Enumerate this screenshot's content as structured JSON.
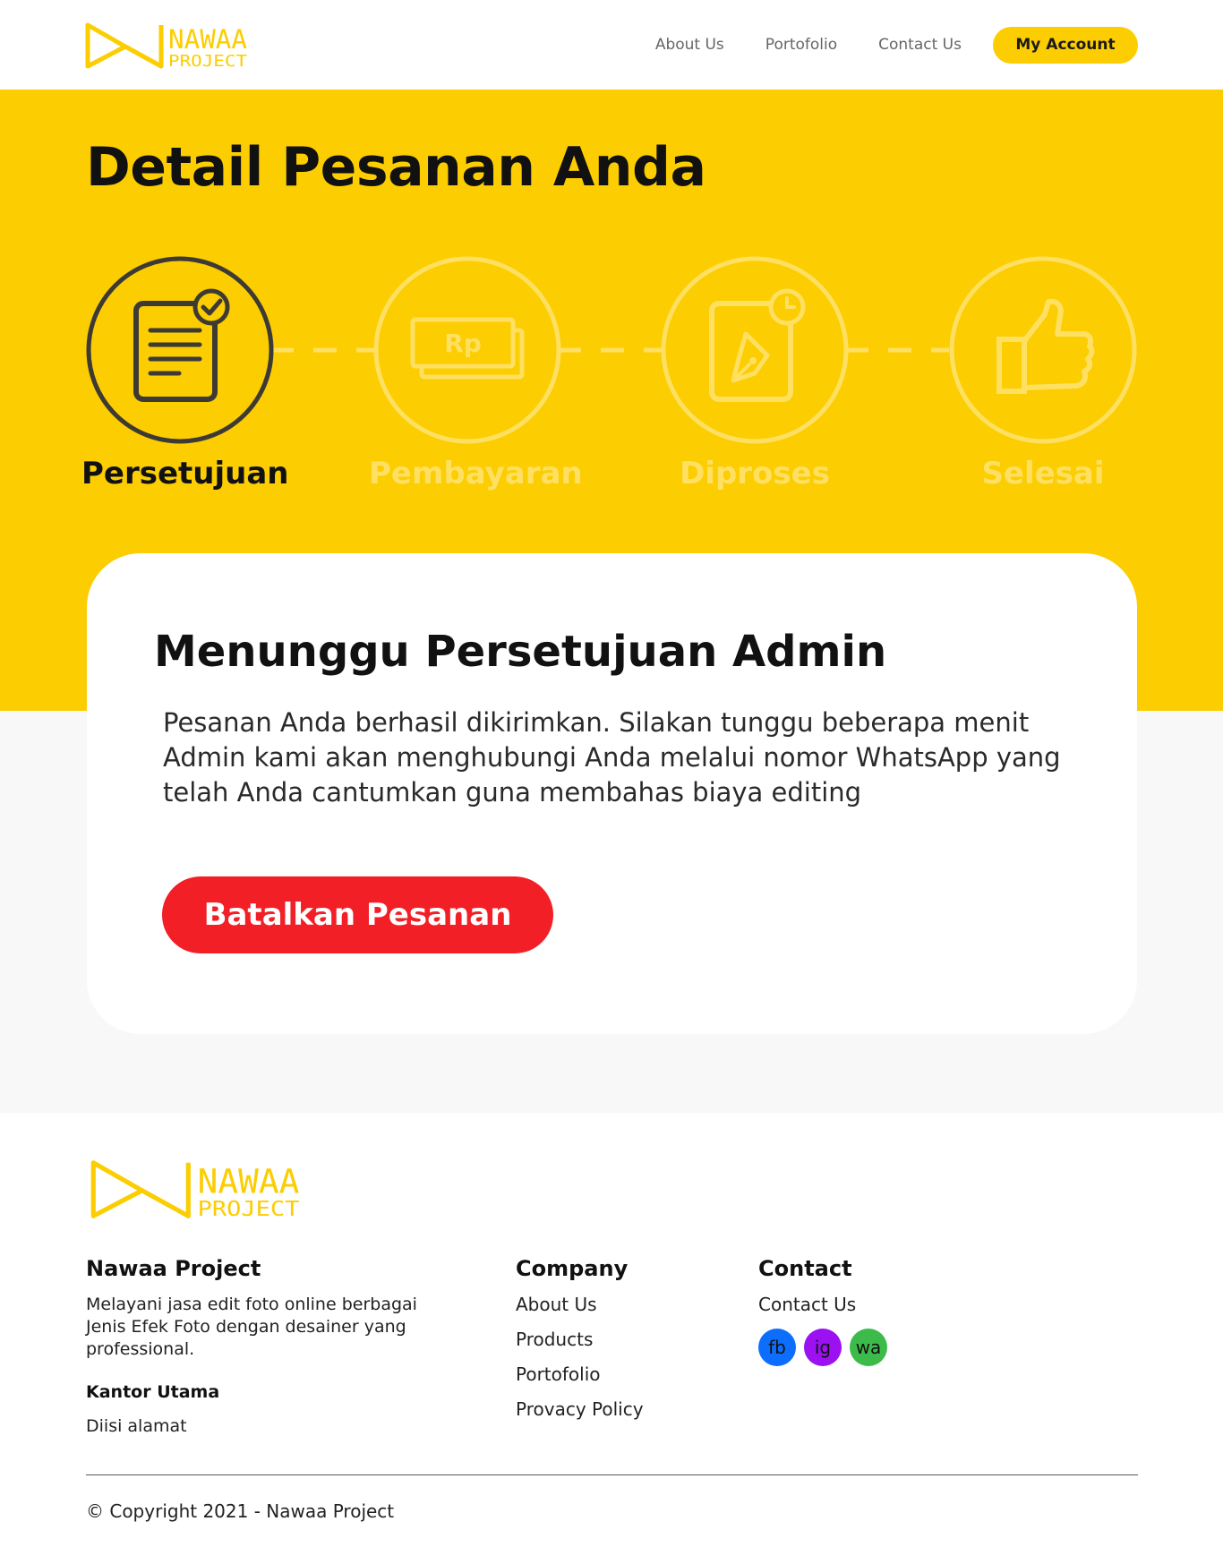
{
  "colors": {
    "brand_yellow": "#fccd01",
    "danger_red": "#f21f26",
    "facebook": "#0d6efd",
    "instagram": "#9b11f2",
    "whatsapp": "#3dbb4a"
  },
  "logo": {
    "line1": "NAWAA",
    "line2": "PROJECT"
  },
  "nav": {
    "links": [
      "About Us",
      "Portofolio",
      "Contact Us"
    ],
    "account_label": "My Account"
  },
  "hero": {
    "title": "Detail Pesanan Anda"
  },
  "steps": [
    {
      "label": "Persetujuan",
      "icon": "document-check-icon",
      "active": true
    },
    {
      "label": "Pembayaran",
      "icon": "money-rp-icon",
      "active": false,
      "icon_text": "Rp"
    },
    {
      "label": "Diproses",
      "icon": "edit-pen-clock-icon",
      "active": false
    },
    {
      "label": "Selesai",
      "icon": "thumbs-up-icon",
      "active": false
    }
  ],
  "card": {
    "title": "Menunggu Persetujuan Admin",
    "text": "Pesanan Anda berhasil dikirimkan. Silakan tunggu beberapa menit Admin kami akan menghubungi Anda melalui nomor WhatsApp yang telah Anda cantumkan guna membahas biaya editing",
    "cancel_label": "Batalkan Pesanan"
  },
  "footer": {
    "about": {
      "title": "Nawaa Project",
      "desc": "Melayani jasa edit foto online berbagai Jenis Efek Foto dengan desainer yang professional.",
      "office_title": "Kantor Utama",
      "office_address": "Diisi alamat"
    },
    "company": {
      "title": "Company",
      "links": [
        "About Us",
        "Products",
        "Portofolio",
        "Provacy Policy"
      ]
    },
    "contact": {
      "title": "Contact",
      "link": "Contact Us",
      "socials": [
        "fb",
        "ig",
        "wa"
      ]
    },
    "copyright": "© Copyright 2021 - Nawaa Project"
  }
}
